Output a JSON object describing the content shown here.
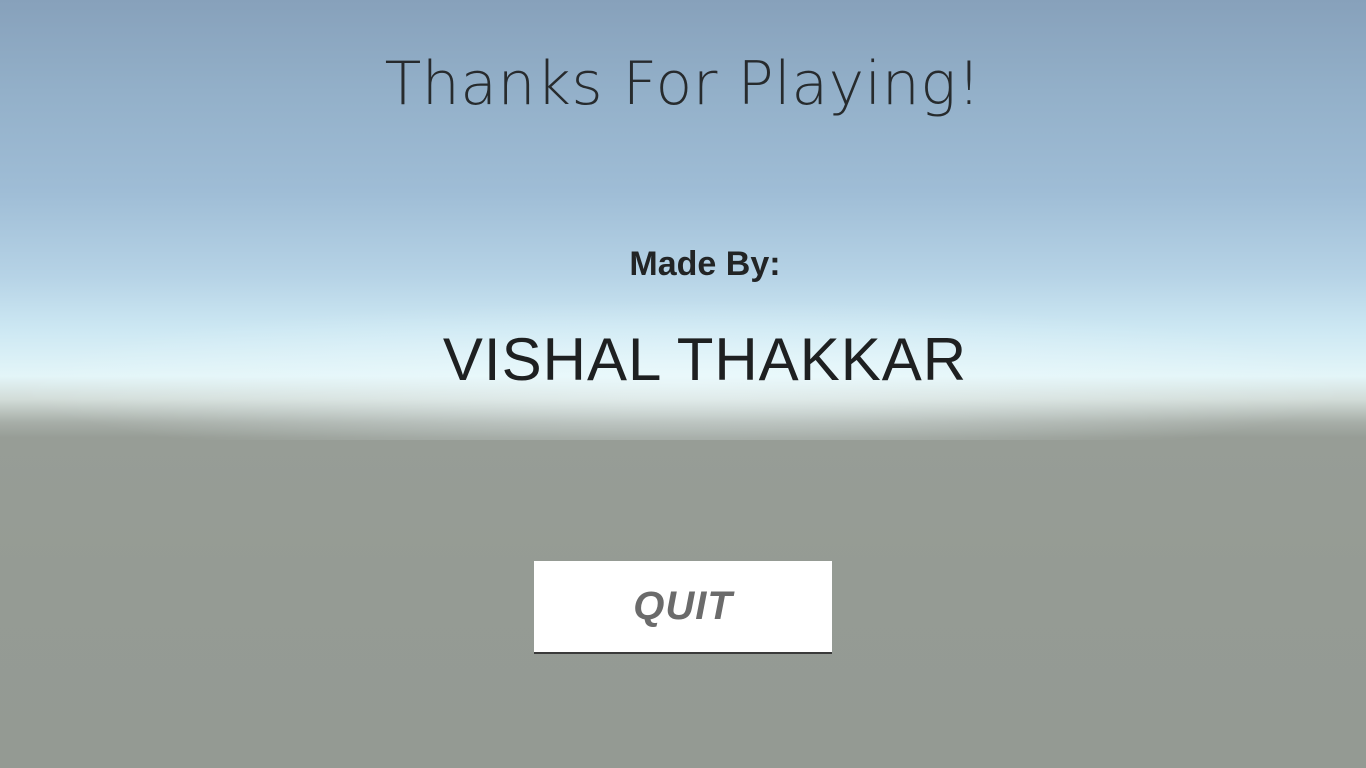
{
  "screen": {
    "title": "Thanks For Playing!",
    "credits_label": "Made By:",
    "credits_name": "VISHAL THAKKAR"
  },
  "actions": {
    "quit_label": "QUIT"
  },
  "colors": {
    "sky_top": "#87a1bb",
    "horizon": "#e3f5f8",
    "ground": "#959b94",
    "text": "#222425",
    "button_bg": "#ffffff",
    "button_text": "#6b6b6b"
  }
}
